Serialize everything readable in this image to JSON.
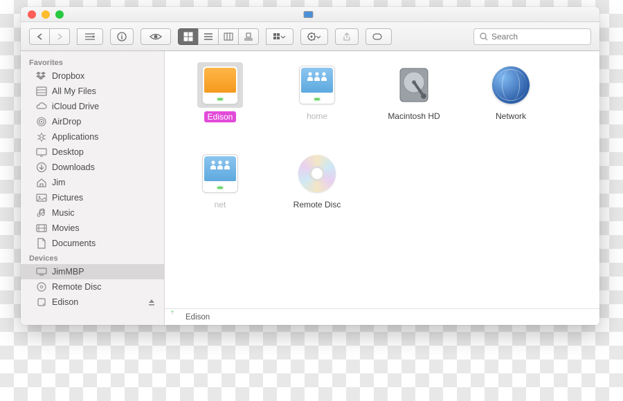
{
  "window": {
    "title": ""
  },
  "search": {
    "placeholder": "Search"
  },
  "sidebar": {
    "sections": [
      {
        "header": "Favorites",
        "items": [
          {
            "label": "Dropbox",
            "icon": "dropbox"
          },
          {
            "label": "All My Files",
            "icon": "allfiles"
          },
          {
            "label": "iCloud Drive",
            "icon": "icloud"
          },
          {
            "label": "AirDrop",
            "icon": "airdrop"
          },
          {
            "label": "Applications",
            "icon": "apps"
          },
          {
            "label": "Desktop",
            "icon": "desktop"
          },
          {
            "label": "Downloads",
            "icon": "downloads"
          },
          {
            "label": "Jim",
            "icon": "home"
          },
          {
            "label": "Pictures",
            "icon": "pictures"
          },
          {
            "label": "Music",
            "icon": "music"
          },
          {
            "label": "Movies",
            "icon": "movies"
          },
          {
            "label": "Documents",
            "icon": "documents"
          }
        ]
      },
      {
        "header": "Devices",
        "items": [
          {
            "label": "JimMBP",
            "icon": "computer",
            "selected": true
          },
          {
            "label": "Remote Disc",
            "icon": "disc"
          },
          {
            "label": "Edison",
            "icon": "drive",
            "eject": true
          }
        ]
      }
    ]
  },
  "items": [
    {
      "label": "Edison",
      "type": "drive-orange",
      "selected": true
    },
    {
      "label": "home",
      "type": "drive-blue-people",
      "dim": true
    },
    {
      "label": "Macintosh HD",
      "type": "hdd"
    },
    {
      "label": "Network",
      "type": "globe"
    },
    {
      "label": "net",
      "type": "drive-blue-people",
      "dim": true
    },
    {
      "label": "Remote Disc",
      "type": "disc"
    }
  ],
  "pathbar": {
    "label": "Edison"
  }
}
